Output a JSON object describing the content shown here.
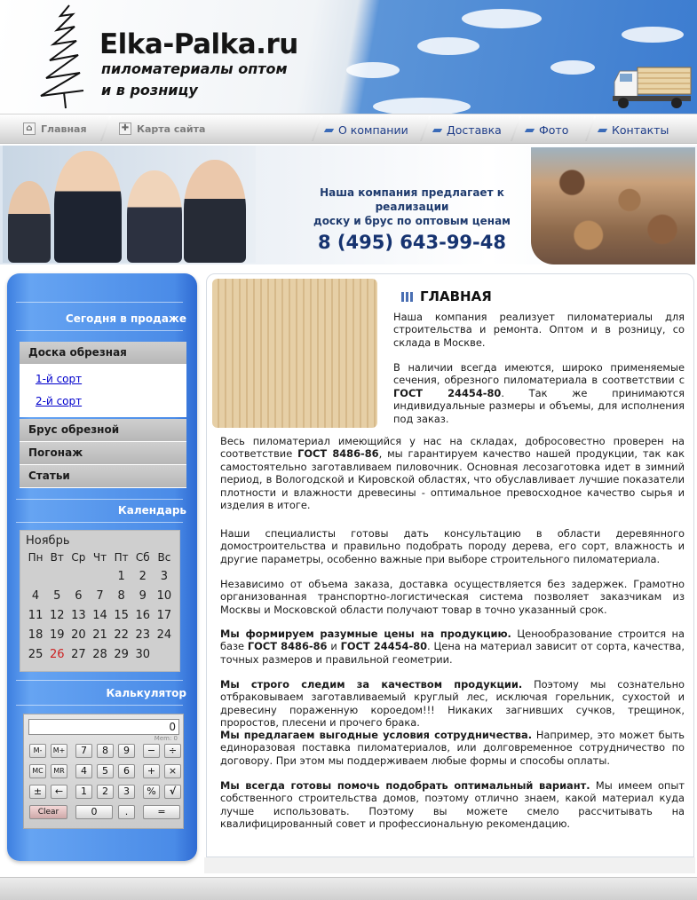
{
  "header": {
    "site_title": "Elka-Palka.ru",
    "tagline_line1": "пиломатериалы оптом",
    "tagline_line2": "и в розницу"
  },
  "nav": {
    "home": "Главная",
    "sitemap": "Карта сайта",
    "about": "О компании",
    "delivery": "Доставка",
    "photo": "Фото",
    "contacts": "Контакты"
  },
  "banner": {
    "offer_line1": "Наша компания предлагает к реализации",
    "offer_line2": "доску и брус по оптовым ценам",
    "phone": "8 (495) 643-99-48"
  },
  "sidebar": {
    "today_heading": "Сегодня в продаже",
    "menu": {
      "item1": "Доска обрезная",
      "sub1": "1-й сорт",
      "sub2": "2-й сорт",
      "item2": "Брус обрезной",
      "item3": "Погонаж",
      "item4": "Статьи"
    },
    "calendar_heading": "Календарь",
    "calculator_heading": "Калькулятор"
  },
  "calendar": {
    "month": "Ноябрь",
    "weekdays": [
      "Пн",
      "Вт",
      "Ср",
      "Чт",
      "Пт",
      "Сб",
      "Вс"
    ],
    "weeks": [
      [
        "",
        "",
        "",
        "",
        "1",
        "2",
        "3"
      ],
      [
        "4",
        "5",
        "6",
        "7",
        "8",
        "9",
        "10"
      ],
      [
        "11",
        "12",
        "13",
        "14",
        "15",
        "16",
        "17"
      ],
      [
        "18",
        "19",
        "20",
        "21",
        "22",
        "23",
        "24"
      ],
      [
        "25",
        "26",
        "27",
        "28",
        "29",
        "30",
        ""
      ]
    ],
    "today": "26",
    "today_color": "#cc2222"
  },
  "calculator": {
    "display": "0",
    "memory_label": "Mem: 0",
    "keys": {
      "mminus": "M-",
      "mplus": "M+",
      "mc": "MC",
      "mr": "MR",
      "seven": "7",
      "eight": "8",
      "nine": "9",
      "four": "4",
      "five": "5",
      "six": "6",
      "one": "1",
      "two": "2",
      "three": "3",
      "zero": "0",
      "dot": ".",
      "minus": "−",
      "divide": "÷",
      "plus": "+",
      "times": "×",
      "plusminus": "±",
      "backspace": "←",
      "percent": "%",
      "sqrt": "√",
      "clear": "Clear",
      "equals": "="
    }
  },
  "content": {
    "title": "ГЛАВНАЯ",
    "p1": "Наша компания реализует пиломатериалы для строительства и ремонта. Оптом и в розницу, со склада в Москве.",
    "p2_a": "В наличии всегда имеются, широко применяемые сечения, обрезного пиломатериала в соответствии с ",
    "p2_b": "ГОСТ 24454-80",
    "p2_c": ". Так же принимаются индивидуальные размеры и объемы, для исполнения под заказ.",
    "p3_a": "Весь пиломатериал имеющийся у нас на складах, добросовестно проверен на соответствие ",
    "p3_b": "ГОСТ 8486-86",
    "p3_c": ", мы гарантируем качество нашей продукции, так как самостоятельно заготавливаем пиловочник. Основная лесозаготовка идет в зимний период, в Вологодской и Кировской областях, что обуславливает лучшие показатели плотности и влажности древесины - оптимальное превосходное качество сырья и изделия в итоге.",
    "p4": "Наши специалисты готовы дать консультацию в области деревянного домостроительства и правильно подобрать породу дерева, его сорт, влажность и другие параметры, особенно важные при выборе строительного пиломатериала.",
    "p5": "Независимо от объема заказа, доставка осуществляется без задержек. Грамотно организованная транспортно-логистическая система позволяет заказчикам из Москвы и Московской области получают товар в точно указанный срок.",
    "p6_a": "Мы формируем разумные цены на продукцию.",
    "p6_b": " Ценообразование строится на базе ",
    "p6_c": "ГОСТ 8486-86",
    "p6_d": " и ",
    "p6_e": "ГОСТ 24454-80",
    "p6_f": ". Цена на материал зависит от сорта, качества, точных размеров и правильной геометрии.",
    "p7_a": "Мы строго следим за качеством продукции.",
    "p7_b": " Поэтому мы сознательно отбраковываем заготавливаемый круглый лес, исключая горельник, сухостой и древесину пораженную короедом!!! Никаких загнивших сучков, трещинок, проростов, плесени и прочего брака.",
    "p8_a": "Мы предлагаем выгодные условия сотрудничества.",
    "p8_b": " Например, это может быть единоразовая поставка пиломатериалов, или долговременное сотрудничество по договору. При этом мы поддерживаем любые формы и способы оплаты.",
    "p9_a": "Мы всегда готовы помочь подобрать оптимальный вариант.",
    "p9_b": " Мы имеем опыт собственного строительства домов, поэтому отлично знаем, какой материал куда лучше использовать. Поэтому вы можете смело рассчитывать на квалифицированный совет и профессиональную рекомендацию."
  },
  "icons": {
    "home": "home-icon",
    "sitemap": "sitemap-icon",
    "nav_marker": "nav-marker-icon",
    "heading_bars": "heading-bars-icon"
  },
  "colors": {
    "sidebar_blue": "#4a8be7",
    "nav_text": "#1d3c88",
    "phone": "#163370",
    "link": "#0000cc"
  }
}
